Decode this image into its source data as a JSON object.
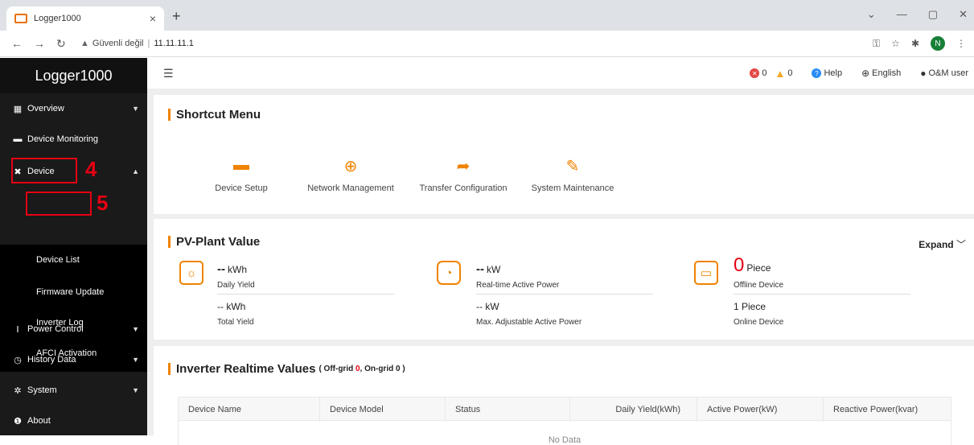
{
  "browser": {
    "tab_title": "Logger1000",
    "tab_close": "×",
    "new_tab": "+",
    "security_label": "Güvenli değil",
    "url": "11.11.11.1",
    "profile_initial": "N"
  },
  "app": {
    "brand": "Logger1000"
  },
  "sidebar": {
    "items": [
      {
        "label": "Overview",
        "icon": "grid-icon"
      },
      {
        "label": "Device Monitoring",
        "icon": "monitor-icon"
      },
      {
        "label": "Device",
        "icon": "wrench-icon"
      },
      {
        "label": "Power Control",
        "icon": "tower-icon"
      },
      {
        "label": "History Data",
        "icon": "clock-icon"
      },
      {
        "label": "System",
        "icon": "gear-icon"
      },
      {
        "label": "About",
        "icon": "info-icon"
      }
    ],
    "device_submenu": [
      {
        "label": "Device List"
      },
      {
        "label": "Firmware Update"
      },
      {
        "label": "Inverter Log"
      },
      {
        "label": "AFCI Activation"
      }
    ]
  },
  "annotations": {
    "step4": "4",
    "step5": "5",
    "color": "#e60012"
  },
  "topbar": {
    "error_count": "0",
    "warning_count": "0",
    "help": "Help",
    "language": "English",
    "user": "O&M user"
  },
  "shortcut_menu": {
    "title": "Shortcut Menu",
    "items": [
      {
        "label": "Device Setup",
        "icon": "device-setup-icon"
      },
      {
        "label": "Network Management",
        "icon": "network-icon"
      },
      {
        "label": "Transfer Configuration",
        "icon": "transfer-icon"
      },
      {
        "label": "System Maintenance",
        "icon": "maintenance-icon"
      }
    ]
  },
  "pv_plant": {
    "title": "PV-Plant Value",
    "expand": "Expand",
    "daily_yield": {
      "value": "--",
      "unit": "kWh",
      "label": "Daily Yield"
    },
    "total_yield": {
      "value": "-- kWh",
      "label": "Total Yield"
    },
    "active_power": {
      "value": "--",
      "unit": "kW",
      "label": "Real-time Active Power"
    },
    "max_power": {
      "value": "-- kW",
      "label": "Max. Adjustable Active Power"
    },
    "offline": {
      "value": "0",
      "unit": "Piece",
      "label": "Offline Device"
    },
    "online": {
      "value": "1 Piece",
      "label": "Online Device"
    }
  },
  "inverter": {
    "title": "Inverter Realtime Values",
    "sub_open": "( Off-grid ",
    "offgrid_count": "0",
    "sub_mid": ", On-grid ",
    "ongrid_count": "0",
    "sub_close": " )",
    "columns": [
      "Device Name",
      "Device Model",
      "Status",
      "Daily Yield(kWh)",
      "Active Power(kW)",
      "Reactive Power(kvar)"
    ],
    "empty": "No Data"
  },
  "colors": {
    "accent": "#f08300",
    "sidebar_bg": "#1a1a1a",
    "alert_red": "#e60012"
  }
}
